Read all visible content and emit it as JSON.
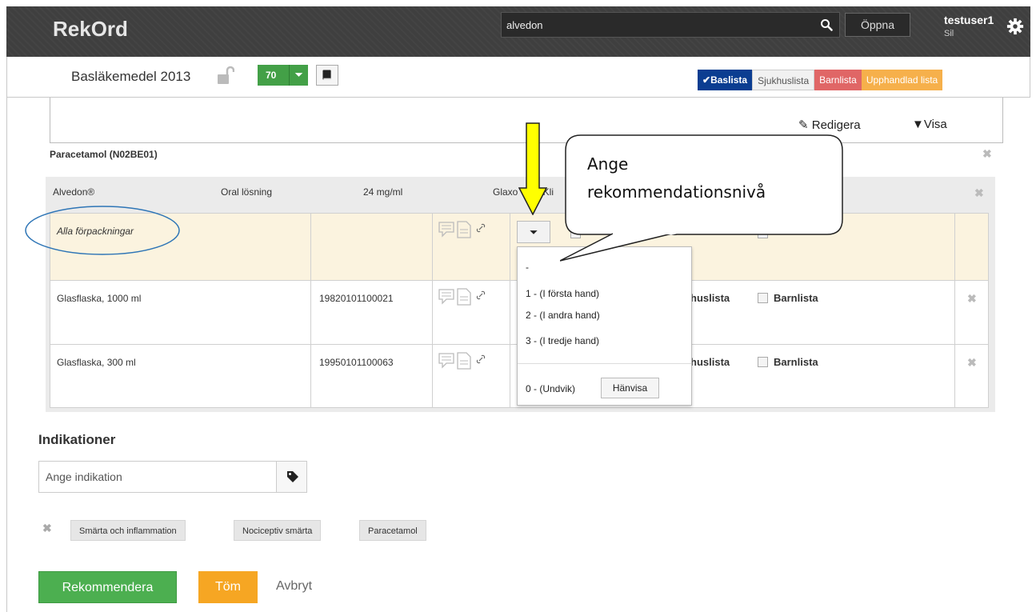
{
  "header": {
    "brand": "RekOrd",
    "search_value": "alvedon",
    "open_label": "Öppna",
    "user_name": "testuser1",
    "user_role": "Sil"
  },
  "subbar": {
    "list_name": "Basläkemedel 2013",
    "count": "70",
    "tabs": [
      "Baslista",
      "Sjukhuslista",
      "Barnlista",
      "Upphandlad lista"
    ],
    "tab_colors": [
      "#0b3d91",
      "#f1f1f1",
      "#e06666",
      "#f6b04b"
    ]
  },
  "panel": {
    "edit_label": "Redigera",
    "show_label": "Visa"
  },
  "substance": {
    "title": "Paracetamol (N02BE01)"
  },
  "product": {
    "name": "Alvedon®",
    "form": "Oral lösning",
    "strength": "24 mg/ml",
    "manufacturer_visible": "Glaxo",
    "manufacturer_tail": "hKli"
  },
  "packages": [
    {
      "name": "Alla förpackningar",
      "code": ""
    },
    {
      "name": "Glasflaska, 1000 ml",
      "code": "19820101100021",
      "list_a": "huslista",
      "list_b": "Barnlista"
    },
    {
      "name": "Glasflaska, 300 ml",
      "code": "19950101100063",
      "list_a": "huslista",
      "list_b": "Barnlista"
    }
  ],
  "dropdown": {
    "options": [
      "-",
      "1 - (I första hand)",
      "2 - (I andra hand)",
      "3 - (I tredje hand)"
    ],
    "avoid_label": "0 - (Undvik)",
    "refer_label": "Hänvisa"
  },
  "annotation": {
    "callout_line1": "Ange",
    "callout_line2": "rekommendationsnivå",
    "arrow_color": "#ffff00",
    "oval_color": "#2e75b6"
  },
  "indications": {
    "title": "Indikationer",
    "placeholder": "Ange indikation",
    "tags": [
      "Smärta och inflammation",
      "Nociceptiv smärta",
      "Paracetamol"
    ]
  },
  "actions": {
    "recommend": "Rekommendera",
    "clear": "Töm",
    "cancel": "Avbryt"
  }
}
